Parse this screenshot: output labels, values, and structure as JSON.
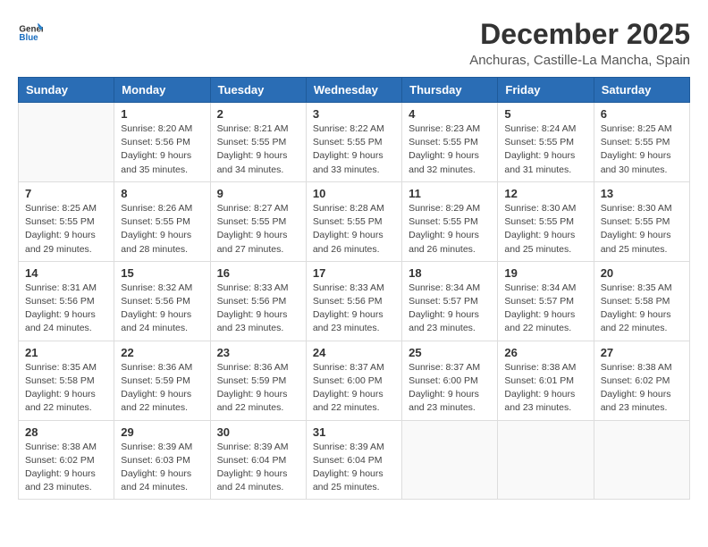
{
  "logo": {
    "text_general": "General",
    "text_blue": "Blue"
  },
  "header": {
    "title": "December 2025",
    "subtitle": "Anchuras, Castille-La Mancha, Spain"
  },
  "weekdays": [
    "Sunday",
    "Monday",
    "Tuesday",
    "Wednesday",
    "Thursday",
    "Friday",
    "Saturday"
  ],
  "weeks": [
    [
      {
        "day": "",
        "sunrise": "",
        "sunset": "",
        "daylight": ""
      },
      {
        "day": "1",
        "sunrise": "Sunrise: 8:20 AM",
        "sunset": "Sunset: 5:56 PM",
        "daylight": "Daylight: 9 hours and 35 minutes."
      },
      {
        "day": "2",
        "sunrise": "Sunrise: 8:21 AM",
        "sunset": "Sunset: 5:55 PM",
        "daylight": "Daylight: 9 hours and 34 minutes."
      },
      {
        "day": "3",
        "sunrise": "Sunrise: 8:22 AM",
        "sunset": "Sunset: 5:55 PM",
        "daylight": "Daylight: 9 hours and 33 minutes."
      },
      {
        "day": "4",
        "sunrise": "Sunrise: 8:23 AM",
        "sunset": "Sunset: 5:55 PM",
        "daylight": "Daylight: 9 hours and 32 minutes."
      },
      {
        "day": "5",
        "sunrise": "Sunrise: 8:24 AM",
        "sunset": "Sunset: 5:55 PM",
        "daylight": "Daylight: 9 hours and 31 minutes."
      },
      {
        "day": "6",
        "sunrise": "Sunrise: 8:25 AM",
        "sunset": "Sunset: 5:55 PM",
        "daylight": "Daylight: 9 hours and 30 minutes."
      }
    ],
    [
      {
        "day": "7",
        "sunrise": "Sunrise: 8:25 AM",
        "sunset": "Sunset: 5:55 PM",
        "daylight": "Daylight: 9 hours and 29 minutes."
      },
      {
        "day": "8",
        "sunrise": "Sunrise: 8:26 AM",
        "sunset": "Sunset: 5:55 PM",
        "daylight": "Daylight: 9 hours and 28 minutes."
      },
      {
        "day": "9",
        "sunrise": "Sunrise: 8:27 AM",
        "sunset": "Sunset: 5:55 PM",
        "daylight": "Daylight: 9 hours and 27 minutes."
      },
      {
        "day": "10",
        "sunrise": "Sunrise: 8:28 AM",
        "sunset": "Sunset: 5:55 PM",
        "daylight": "Daylight: 9 hours and 26 minutes."
      },
      {
        "day": "11",
        "sunrise": "Sunrise: 8:29 AM",
        "sunset": "Sunset: 5:55 PM",
        "daylight": "Daylight: 9 hours and 26 minutes."
      },
      {
        "day": "12",
        "sunrise": "Sunrise: 8:30 AM",
        "sunset": "Sunset: 5:55 PM",
        "daylight": "Daylight: 9 hours and 25 minutes."
      },
      {
        "day": "13",
        "sunrise": "Sunrise: 8:30 AM",
        "sunset": "Sunset: 5:55 PM",
        "daylight": "Daylight: 9 hours and 25 minutes."
      }
    ],
    [
      {
        "day": "14",
        "sunrise": "Sunrise: 8:31 AM",
        "sunset": "Sunset: 5:56 PM",
        "daylight": "Daylight: 9 hours and 24 minutes."
      },
      {
        "day": "15",
        "sunrise": "Sunrise: 8:32 AM",
        "sunset": "Sunset: 5:56 PM",
        "daylight": "Daylight: 9 hours and 24 minutes."
      },
      {
        "day": "16",
        "sunrise": "Sunrise: 8:33 AM",
        "sunset": "Sunset: 5:56 PM",
        "daylight": "Daylight: 9 hours and 23 minutes."
      },
      {
        "day": "17",
        "sunrise": "Sunrise: 8:33 AM",
        "sunset": "Sunset: 5:56 PM",
        "daylight": "Daylight: 9 hours and 23 minutes."
      },
      {
        "day": "18",
        "sunrise": "Sunrise: 8:34 AM",
        "sunset": "Sunset: 5:57 PM",
        "daylight": "Daylight: 9 hours and 23 minutes."
      },
      {
        "day": "19",
        "sunrise": "Sunrise: 8:34 AM",
        "sunset": "Sunset: 5:57 PM",
        "daylight": "Daylight: 9 hours and 22 minutes."
      },
      {
        "day": "20",
        "sunrise": "Sunrise: 8:35 AM",
        "sunset": "Sunset: 5:58 PM",
        "daylight": "Daylight: 9 hours and 22 minutes."
      }
    ],
    [
      {
        "day": "21",
        "sunrise": "Sunrise: 8:35 AM",
        "sunset": "Sunset: 5:58 PM",
        "daylight": "Daylight: 9 hours and 22 minutes."
      },
      {
        "day": "22",
        "sunrise": "Sunrise: 8:36 AM",
        "sunset": "Sunset: 5:59 PM",
        "daylight": "Daylight: 9 hours and 22 minutes."
      },
      {
        "day": "23",
        "sunrise": "Sunrise: 8:36 AM",
        "sunset": "Sunset: 5:59 PM",
        "daylight": "Daylight: 9 hours and 22 minutes."
      },
      {
        "day": "24",
        "sunrise": "Sunrise: 8:37 AM",
        "sunset": "Sunset: 6:00 PM",
        "daylight": "Daylight: 9 hours and 22 minutes."
      },
      {
        "day": "25",
        "sunrise": "Sunrise: 8:37 AM",
        "sunset": "Sunset: 6:00 PM",
        "daylight": "Daylight: 9 hours and 23 minutes."
      },
      {
        "day": "26",
        "sunrise": "Sunrise: 8:38 AM",
        "sunset": "Sunset: 6:01 PM",
        "daylight": "Daylight: 9 hours and 23 minutes."
      },
      {
        "day": "27",
        "sunrise": "Sunrise: 8:38 AM",
        "sunset": "Sunset: 6:02 PM",
        "daylight": "Daylight: 9 hours and 23 minutes."
      }
    ],
    [
      {
        "day": "28",
        "sunrise": "Sunrise: 8:38 AM",
        "sunset": "Sunset: 6:02 PM",
        "daylight": "Daylight: 9 hours and 23 minutes."
      },
      {
        "day": "29",
        "sunrise": "Sunrise: 8:39 AM",
        "sunset": "Sunset: 6:03 PM",
        "daylight": "Daylight: 9 hours and 24 minutes."
      },
      {
        "day": "30",
        "sunrise": "Sunrise: 8:39 AM",
        "sunset": "Sunset: 6:04 PM",
        "daylight": "Daylight: 9 hours and 24 minutes."
      },
      {
        "day": "31",
        "sunrise": "Sunrise: 8:39 AM",
        "sunset": "Sunset: 6:04 PM",
        "daylight": "Daylight: 9 hours and 25 minutes."
      },
      {
        "day": "",
        "sunrise": "",
        "sunset": "",
        "daylight": ""
      },
      {
        "day": "",
        "sunrise": "",
        "sunset": "",
        "daylight": ""
      },
      {
        "day": "",
        "sunrise": "",
        "sunset": "",
        "daylight": ""
      }
    ]
  ]
}
